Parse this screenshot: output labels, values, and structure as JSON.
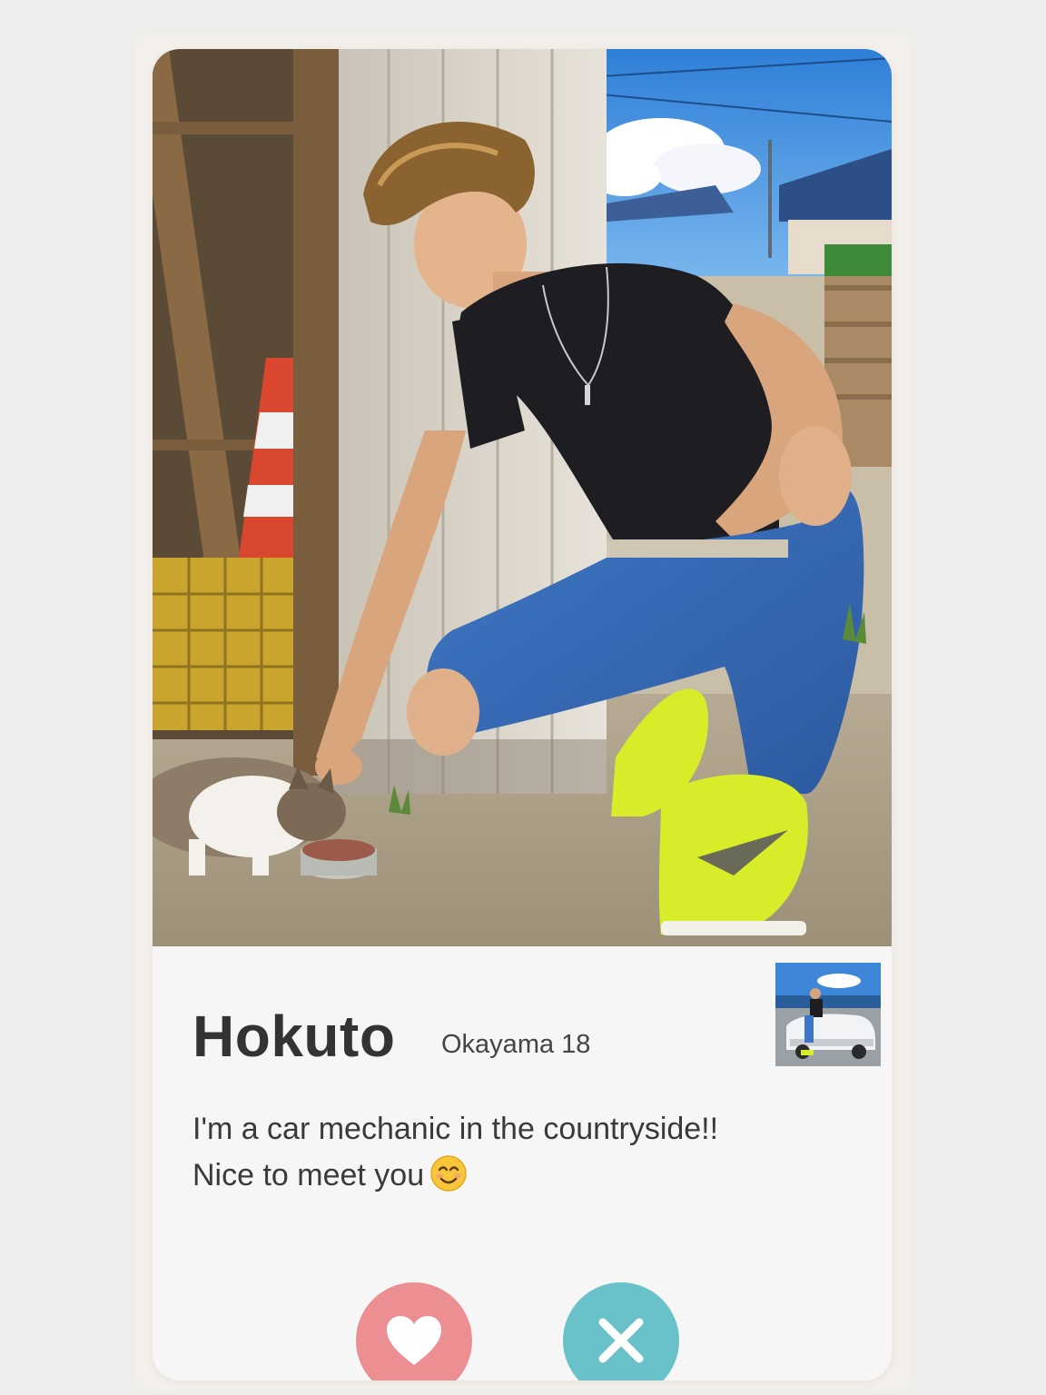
{
  "profile": {
    "name": "Hokuto",
    "location_age": "Okayama 18",
    "bio_line1": "I'm a car mechanic in the countryside!!",
    "bio_line2": "Nice to meet you",
    "bio_emoji": "smiling-face-icon"
  },
  "actions": {
    "like": {
      "icon": "heart-icon",
      "color": "#ec8f93"
    },
    "dislike": {
      "icon": "close-icon",
      "color": "#69c2c9"
    }
  },
  "colors": {
    "background": "#efedeb",
    "card": "#f7f6f6",
    "name_text": "#333333"
  }
}
